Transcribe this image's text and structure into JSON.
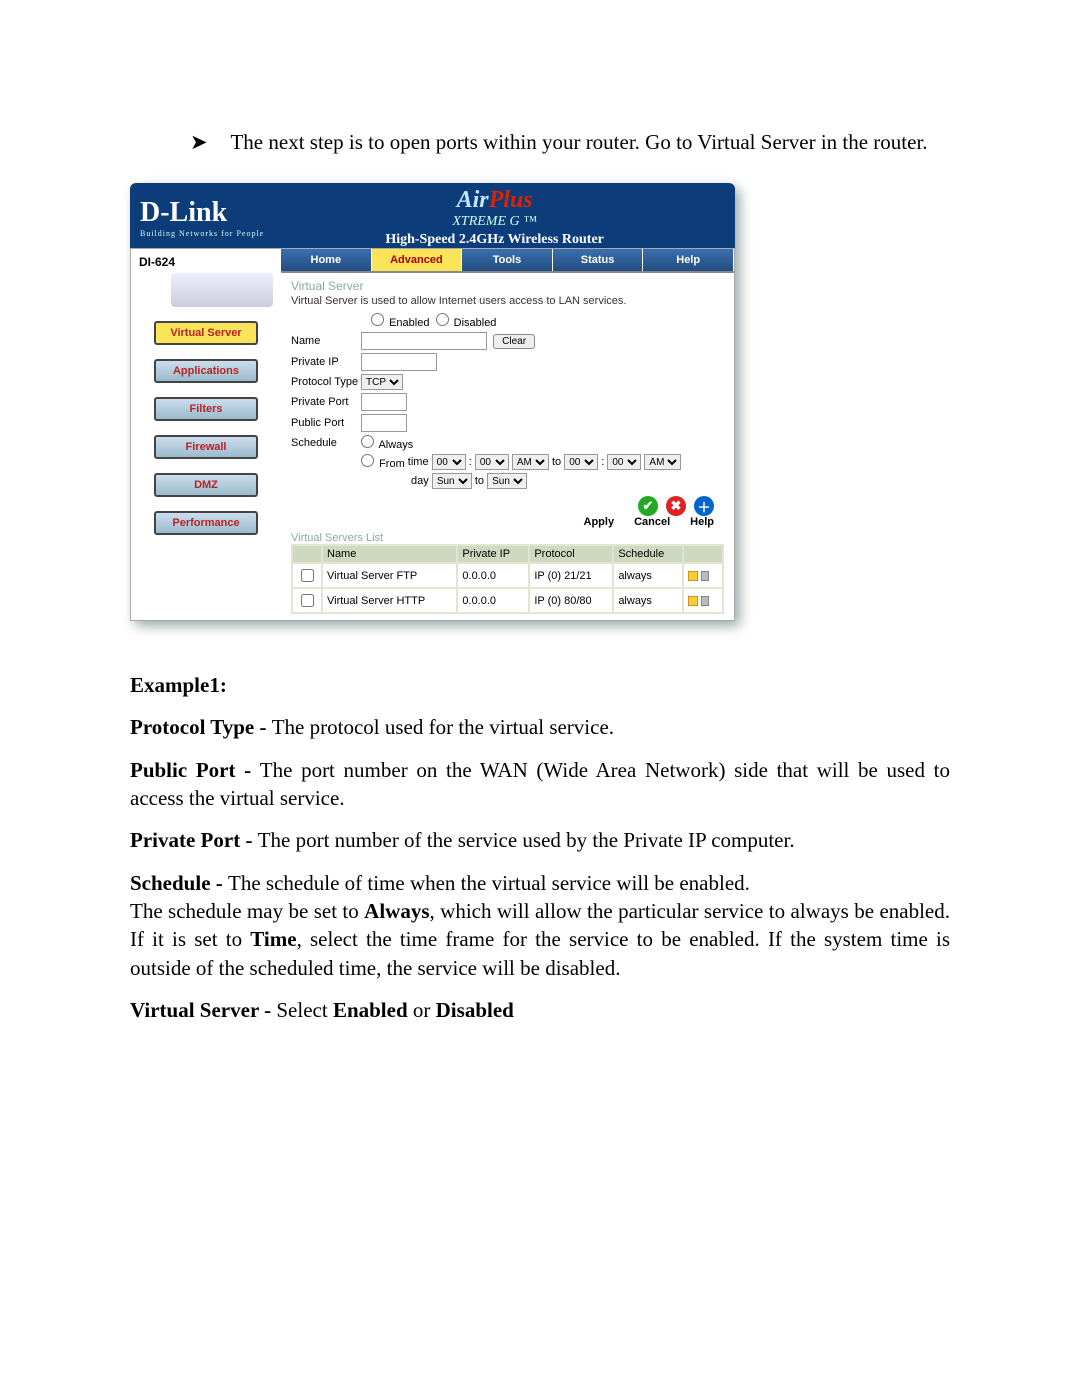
{
  "bullet": "The next step is to open ports within your router. Go to Virtual Server in the router.",
  "brand": {
    "name": "D-Link",
    "tag": "Building Networks for People"
  },
  "air": {
    "line1a": "Air",
    "line1b": "Plus",
    "xtreme": "XTREME G",
    "hs": "High-Speed 2.4GHz Wireless Router",
    "tm": "™"
  },
  "model": "DI-624",
  "side": {
    "vs": "Virtual Server",
    "apps": "Applications",
    "filters": "Filters",
    "fw": "Firewall",
    "dmz": "DMZ",
    "perf": "Performance"
  },
  "tabs": {
    "home": "Home",
    "adv": "Advanced",
    "tools": "Tools",
    "status": "Status",
    "help": "Help"
  },
  "vs": {
    "title": "Virtual Server",
    "desc": "Virtual Server is used to allow Internet users access to LAN services.",
    "enabled": "Enabled",
    "disabled": "Disabled",
    "labels": {
      "name": "Name",
      "pip": "Private IP",
      "ptype": "Protocol Type",
      "pport": "Private Port",
      "pub": "Public Port",
      "sched": "Schedule"
    },
    "clear": "Clear",
    "protocol_value": "TCP",
    "sched_always": "Always",
    "sched_from": "From",
    "time_word": "time",
    "day_word": "day",
    "to_word": "to",
    "time": {
      "h1": "00",
      "m1": "00",
      "ap1": "AM",
      "h2": "00",
      "m2": "00",
      "ap2": "AM",
      "d1": "Sun",
      "d2": "Sun"
    }
  },
  "list": {
    "title": "Virtual Servers List",
    "cols": {
      "name": "Name",
      "pip": "Private IP",
      "proto": "Protocol",
      "sched": "Schedule"
    },
    "rows": [
      {
        "name": "Virtual Server FTP",
        "ip": "0.0.0.0",
        "proto": "IP (0) 21/21",
        "sched": "always"
      },
      {
        "name": "Virtual Server HTTP",
        "ip": "0.0.0.0",
        "proto": "IP (0) 80/80",
        "sched": "always"
      }
    ],
    "actions": {
      "apply": "Apply",
      "cancel": "Cancel",
      "help": "Help"
    }
  },
  "doc": {
    "ex": "Example1:",
    "p1a": "Protocol Type - ",
    "p1b": "The protocol used for the virtual service.",
    "p2a": "Public Port - ",
    "p2b": "The port number on the WAN (Wide Area Network) side that will be used to access the virtual service.",
    "p3a": "Private Port - ",
    "p3b": "The port number of the service used by the Private IP computer.",
    "p4a": "Schedule - ",
    "p4b": "The schedule of time when the virtual service will be enabled.",
    "p4c1": "The schedule may be set to ",
    "always": "Always",
    "p4c2": ", which will allow the particular service to always be enabled. If it is set to ",
    "time": "Time",
    "p4c3": ", select the time frame for the service to be enabled. If the system time is outside of the scheduled time, the service will be disabled.",
    "p5a": "Virtual Server - ",
    "p5b": "Select ",
    "en": "Enabled",
    "or": " or ",
    "dis": "Disabled"
  }
}
